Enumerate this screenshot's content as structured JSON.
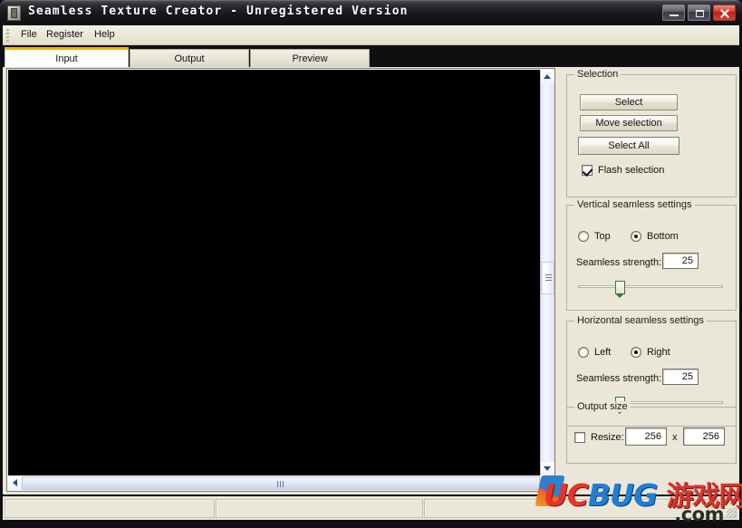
{
  "window": {
    "title": "Seamless Texture Creator - Unregistered Version",
    "icon": "app-texture-icon",
    "minimize_label": "",
    "maximize_label": "",
    "close_label": ""
  },
  "menu": {
    "items": [
      {
        "label": "File"
      },
      {
        "label": "Register"
      },
      {
        "label": "Help"
      }
    ]
  },
  "tabs": [
    {
      "label": "Input",
      "active": true
    },
    {
      "label": "Output",
      "active": false
    },
    {
      "label": "Preview",
      "active": false
    }
  ],
  "canvas": {
    "alt": "black image preview",
    "v_scroll": "vertical-scrollbar",
    "h_scroll": "horizontal-scrollbar"
  },
  "selection_group": {
    "legend": "Selection",
    "select_button": "Select",
    "move_selection_button": "Move selection",
    "select_all_button": "Select All",
    "flash_selection_label": "Flash selection",
    "flash_selection_checked": true
  },
  "vertical_group": {
    "legend": "Vertical seamless settings",
    "top_label": "Top",
    "bottom_label": "Bottom",
    "selected": "Bottom",
    "strength_label": "Seamless strength:",
    "strength_value": "25",
    "slider_percent": 27
  },
  "horizontal_group": {
    "legend": "Horizontal seamless settings",
    "left_label": "Left",
    "right_label": "Right",
    "selected": "Right",
    "strength_label": "Seamless strength:",
    "strength_value": "25",
    "slider_percent": 27
  },
  "output_group": {
    "legend": "Output size",
    "resize_label": "Resize:",
    "resize_checked": false,
    "width_value": "256",
    "times_label": "x",
    "height_value": "256"
  },
  "statusbar": {
    "panel1": "",
    "panel2": "",
    "panel3": ""
  },
  "watermark": {
    "uc": "UC",
    "bug": "BUG",
    "cn": "游戏网",
    "com": ".com"
  },
  "colors": {
    "accent_tab": "#f0b400",
    "panel_bg": "#eae7d8",
    "slider_thumb": "#2f7a2f",
    "close_button": "#d93b2c"
  }
}
